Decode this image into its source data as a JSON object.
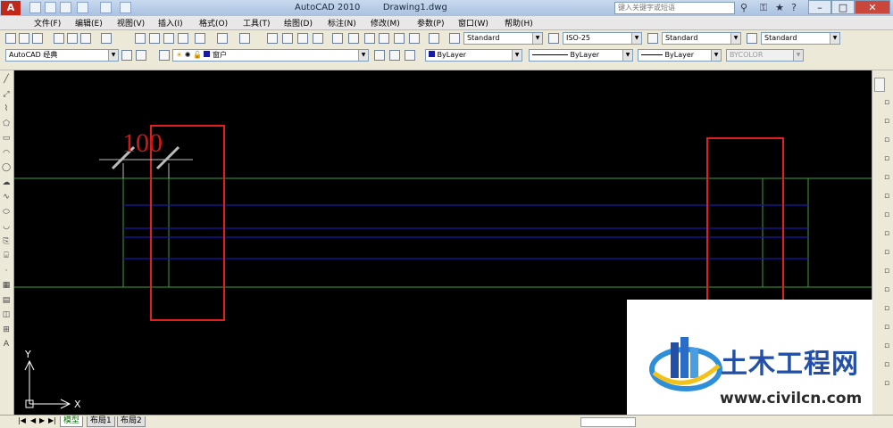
{
  "app": {
    "logo": "A",
    "title": "AutoCAD 2010",
    "document": "Drawing1.dwg",
    "search_placeholder": "键入关键字或短语"
  },
  "menu": [
    "文件(F)",
    "编辑(E)",
    "视图(V)",
    "插入(I)",
    "格式(O)",
    "工具(T)",
    "绘图(D)",
    "标注(N)",
    "修改(M)",
    "参数(P)",
    "窗口(W)",
    "帮助(H)"
  ],
  "styles_toolbar": {
    "text_style": "Standard",
    "dim_style": "ISO-25",
    "table_style": "Standard",
    "multileader_style": "Standard"
  },
  "layers_toolbar": {
    "workspace": "AutoCAD 经典",
    "layer": "窗户",
    "color": "ByLayer",
    "linetype": "ByLayer",
    "lineweight": "ByLayer",
    "plotstyle": "BYCOLOR"
  },
  "drawing": {
    "dimension_text": "100",
    "ucs_x": "X",
    "ucs_y": "Y",
    "colors": {
      "background": "#000000",
      "wall": "#3fa03f",
      "window": "#1a1aa8",
      "rect": "#e02020",
      "dimension": "#d01818",
      "dim_line": "#bbbbbb"
    }
  },
  "layout_tabs": [
    "模型",
    "布局1",
    "布局2"
  ],
  "watermark": {
    "name": "土木工程网",
    "url": "www.civilcn.com"
  },
  "icons": {
    "left_tools": [
      "line-icon",
      "construction-line-icon",
      "polyline-icon",
      "polygon-icon",
      "rectangle-icon",
      "arc-icon",
      "circle-icon",
      "revcloud-icon",
      "spline-icon",
      "ellipse-icon",
      "ellipse-arc-icon",
      "insert-block-icon",
      "make-block-icon",
      "point-icon",
      "hatch-icon",
      "gradient-icon",
      "region-icon",
      "table-icon",
      "mtext-icon"
    ]
  }
}
